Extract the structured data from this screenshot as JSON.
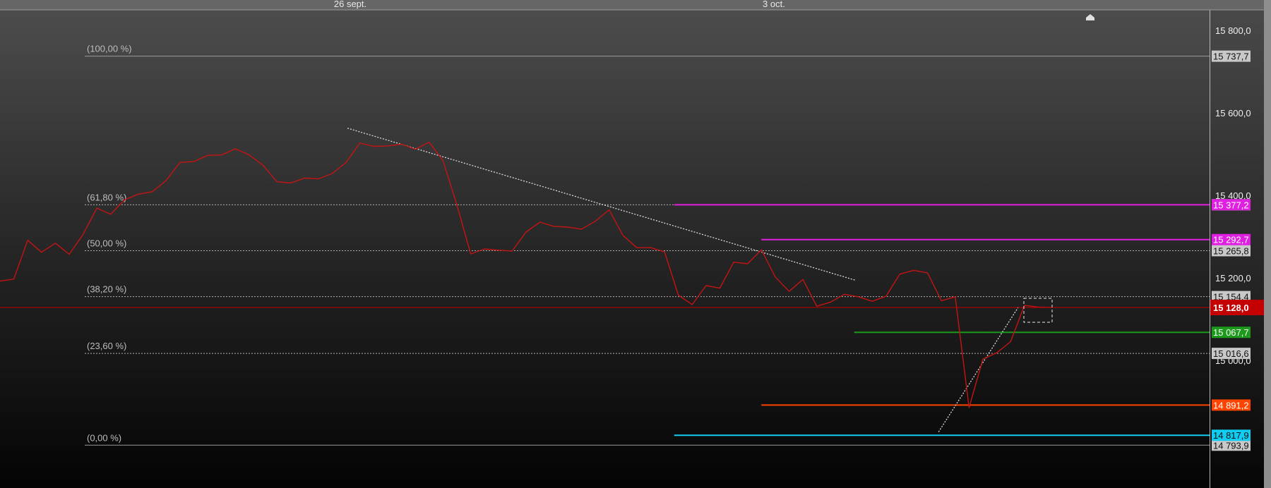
{
  "chart_data": {
    "type": "line",
    "x_ticks": [
      "26 sept.",
      "3 oct."
    ],
    "y_ticks": [
      "15 800,0",
      "15 600,0",
      "15 400,0",
      "15 200,0",
      "15 000,0"
    ],
    "ylim": [
      14690,
      15850
    ],
    "grid": false,
    "series": [
      {
        "color": "#c41414",
        "values": [
          15192,
          15197,
          15291,
          15262,
          15284,
          15257,
          15305,
          15369,
          15354,
          15389,
          15403,
          15409,
          15436,
          15480,
          15482,
          15497,
          15498,
          15513,
          15498,
          15473,
          15433,
          15430,
          15442,
          15440,
          15453,
          15480,
          15527,
          15519,
          15520,
          15524,
          15512,
          15529,
          15484,
          15377,
          15258,
          15270,
          15267,
          15265,
          15311,
          15335,
          15325,
          15323,
          15318,
          15337,
          15365,
          15303,
          15273,
          15273,
          15263,
          15158,
          15135,
          15181,
          15175,
          15238,
          15234,
          15268,
          15202,
          15167,
          15196,
          15131,
          15141,
          15160,
          15154,
          15143,
          15155,
          15209,
          15218,
          15212,
          15144,
          15154,
          14885,
          15003,
          15018,
          15045,
          15133,
          15129,
          15128
        ]
      }
    ],
    "fibonacci": [
      {
        "label": "(100,00 %)",
        "price": "15 737,7",
        "value": 15737.7
      },
      {
        "label": "(61,80 %)",
        "price": "15 377,2",
        "value": 15377.2
      },
      {
        "label": "(50,00 %)",
        "price": "15 265,8",
        "value": 15265.8
      },
      {
        "label": "(38,20 %)",
        "price": "15 154,4",
        "value": 15154.4
      },
      {
        "label": "(23,60 %)",
        "price": "15 016,6",
        "value": 15016.6
      },
      {
        "label": "(0,00 %)",
        "price": "14 793,9",
        "value": 14793.9
      }
    ],
    "current_price": {
      "price": "15 128,0",
      "value": 15128.0,
      "color": "#c40000"
    },
    "levels": [
      {
        "price": "15 377,2",
        "value": 15377.2,
        "color": "#e020e0",
        "start": 48.7
      },
      {
        "price": "15 292,7",
        "value": 15292.7,
        "color": "#e020e0",
        "start": 55.0
      },
      {
        "price": "15 067,7",
        "value": 15067.7,
        "color": "#1b9a1b",
        "start": 61.7
      },
      {
        "price": "14 891,2",
        "value": 14891.2,
        "color": "#ff4400",
        "start": 55.0
      },
      {
        "price": "14 817,9",
        "value": 14817.9,
        "color": "#10ccf0",
        "start": 48.7
      }
    ],
    "trendlines": [
      {
        "from": [
          25.1,
          15563
        ],
        "to": [
          61.8,
          15194
        ]
      },
      {
        "from": [
          67.8,
          14826
        ],
        "to": [
          73.6,
          15131
        ]
      }
    ]
  }
}
